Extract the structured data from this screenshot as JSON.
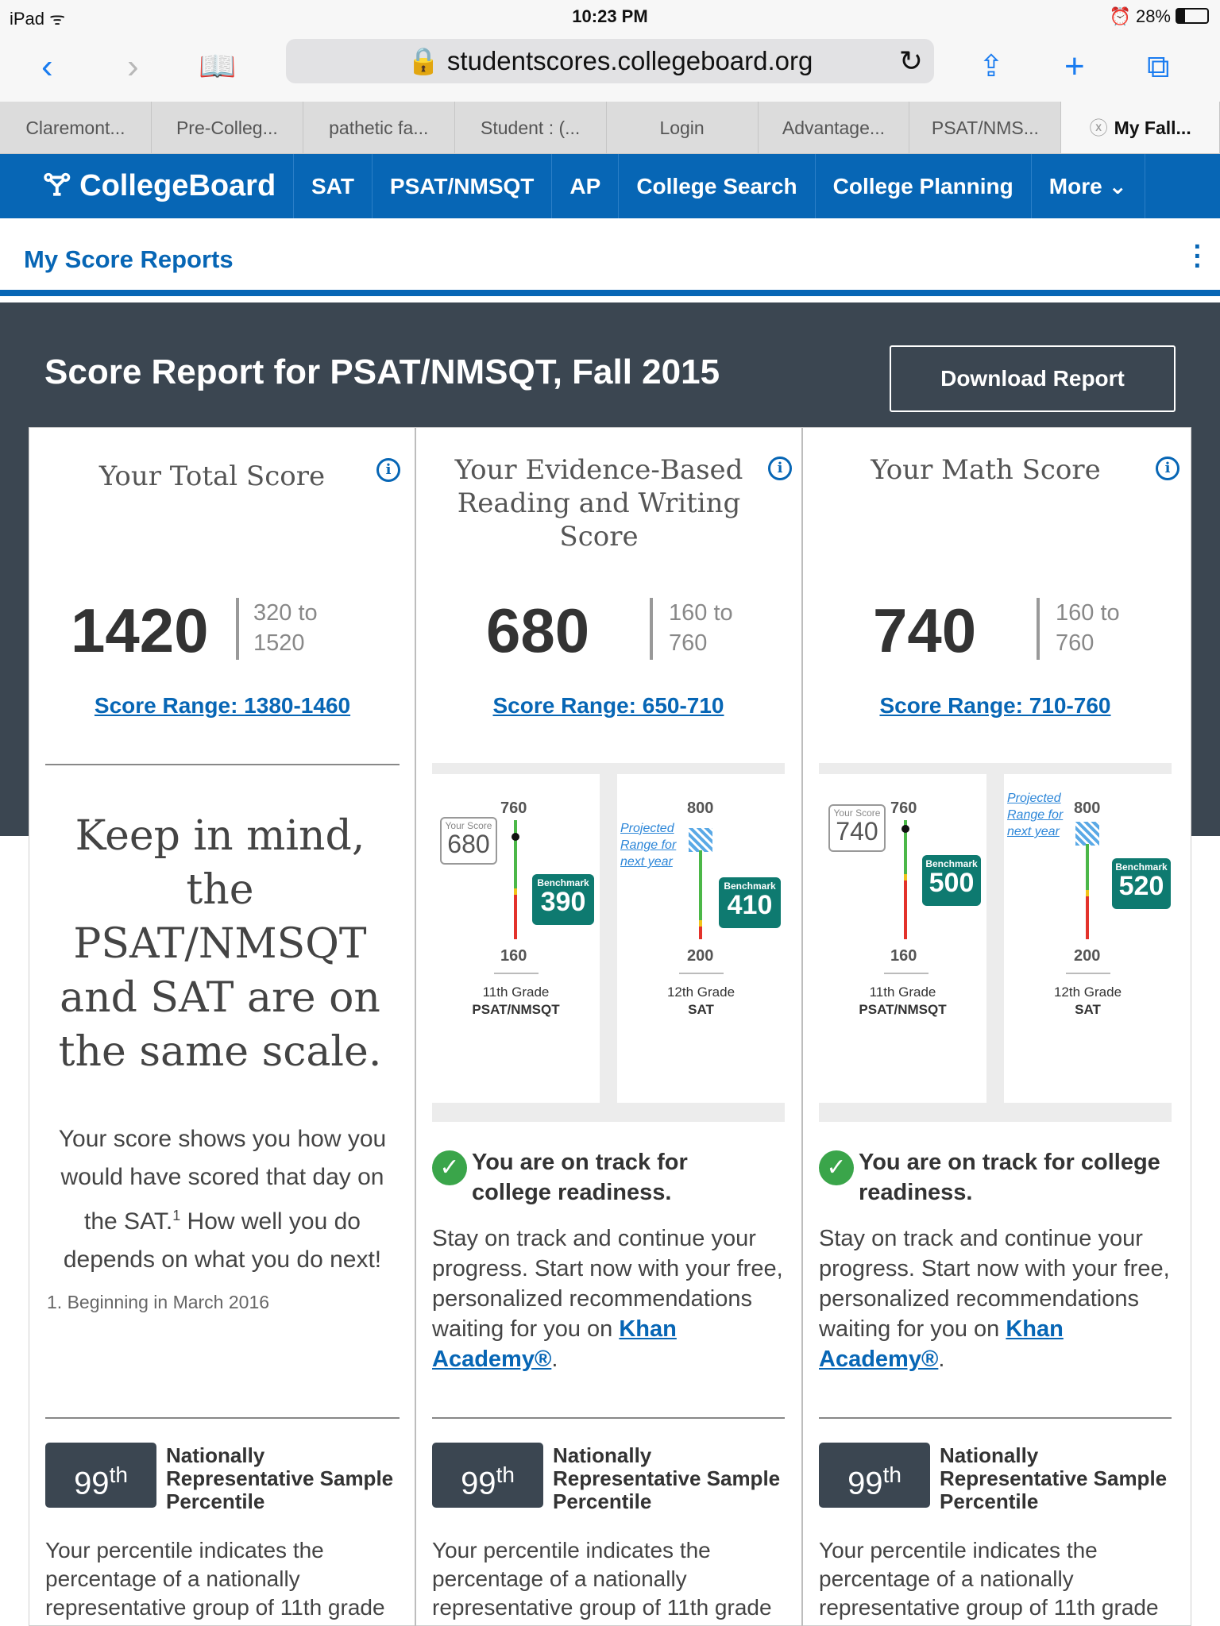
{
  "status": {
    "device": "iPad",
    "time": "10:23 PM",
    "battery": "28%"
  },
  "browser": {
    "url": "studentscores.collegeboard.org",
    "tabs": [
      {
        "label": "Claremont..."
      },
      {
        "label": "Pre-Colleg..."
      },
      {
        "label": "pathetic fa..."
      },
      {
        "label": "Student : (..."
      },
      {
        "label": "Login"
      },
      {
        "label": "Advantage..."
      },
      {
        "label": "PSAT/NMS..."
      },
      {
        "label": "My Fall..."
      }
    ]
  },
  "nav": {
    "logo": "CollegeBoard",
    "items": [
      "SAT",
      "PSAT/NMSQT",
      "AP",
      "College Search",
      "College Planning",
      "More"
    ]
  },
  "subheader": {
    "title": "My Score Reports"
  },
  "report": {
    "title": "Score Report for PSAT/NMSQT, Fall 2015",
    "download": "Download Report"
  },
  "colors": {
    "brand": "#0766b5",
    "dark": "#3b4651",
    "benchmark": "#0e7a70",
    "check": "#3aa54a"
  },
  "total": {
    "title": "Your Total Score",
    "score": "1420",
    "range_from": "320 to",
    "range_to": "1520",
    "score_range": "Score Range: 1380-1460",
    "keep_in_mind": "Keep in mind, the PSAT/NMSQT and SAT are on the same scale.",
    "explain_a": "Your score shows you how you would have scored that day on the SAT.",
    "explain_sup": "1",
    "explain_b": " How well you do depends on what you do next!",
    "footnote": "1. Beginning in March 2016",
    "percentile": "99",
    "percentile_suffix": "th",
    "percentile_label": "Nationally Representative Sample Percentile",
    "percentile_text": "Your percentile indicates the percentage of a nationally representative group of 11th grade"
  },
  "ebrw": {
    "title": "Your Evidence-Based Reading and Writing Score",
    "score": "680",
    "range_from": "160 to",
    "range_to": "760",
    "score_range": "Score Range: 650-710",
    "graph": {
      "psat_top": "760",
      "psat_bottom": "160",
      "your_score_label": "Your Score",
      "your_score": "680",
      "benchmark_label": "Benchmark",
      "psat_benchmark": "390",
      "sat_top": "800",
      "sat_bottom": "200",
      "sat_benchmark": "410",
      "projected": "Projected Range for next year",
      "grade11": "11th Grade",
      "test11": "PSAT/NMSQT",
      "grade12": "12th Grade",
      "test12": "SAT"
    },
    "ontrack": "You are on track for college readiness.",
    "advice": "Stay on track and continue your progress. Start now with your free, personalized recommendations waiting for you on ",
    "khan": "Khan Academy®",
    "percentile": "99",
    "percentile_suffix": "th",
    "percentile_label": "Nationally Representative Sample Percentile",
    "percentile_text": "Your percentile indicates the percentage of a nationally representative group of 11th grade"
  },
  "math": {
    "title": "Your Math Score",
    "score": "740",
    "range_from": "160 to",
    "range_to": "760",
    "score_range": "Score Range: 710-760",
    "graph": {
      "psat_top": "760",
      "psat_bottom": "160",
      "your_score_label": "Your Score",
      "your_score": "740",
      "benchmark_label": "Benchmark",
      "psat_benchmark": "500",
      "sat_top": "800",
      "sat_bottom": "200",
      "sat_benchmark": "520",
      "projected": "Projected Range for next year",
      "grade11": "11th Grade",
      "test11": "PSAT/NMSQT",
      "grade12": "12th Grade",
      "test12": "SAT"
    },
    "ontrack": "You are on track for college readiness.",
    "advice": "Stay on track and continue your progress. Start now with your free, personalized recommendations waiting for you on ",
    "khan": "Khan Academy®",
    "percentile": "99",
    "percentile_suffix": "th",
    "percentile_label": "Nationally Representative Sample Percentile",
    "percentile_text": "Your percentile indicates the percentage of a nationally representative group of 11th grade"
  }
}
